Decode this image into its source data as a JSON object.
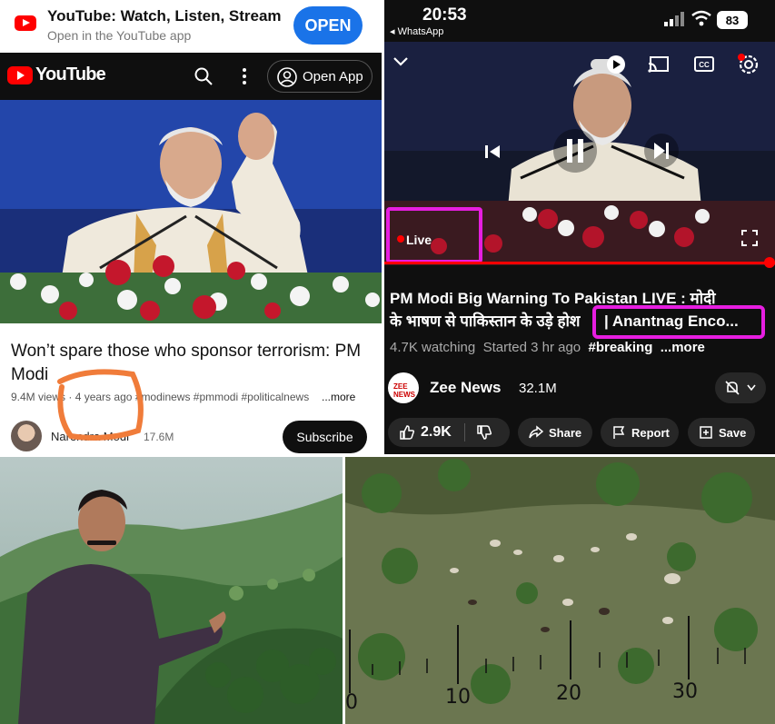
{
  "left_panel": {
    "banner": {
      "title": "YouTube: Watch, Listen, Stream",
      "subtitle": "Open in the YouTube app",
      "open_label": "OPEN"
    },
    "topbar": {
      "logo_text": "YouTube",
      "open_app_label": "Open App"
    },
    "video": {
      "title": "Won’t spare those who sponsor terrorism: PM Modi",
      "views": "9.4M views",
      "age": "4 years ago",
      "hashtags": "#modinews #pmmodi #politicalnews",
      "more_label": "...more",
      "channel_name": "Narendra Modi",
      "subscribers": "17.6M",
      "subscribe_label": "Subscribe"
    },
    "annotation_color": "#f07c3a"
  },
  "right_panel": {
    "status_bar": {
      "time": "20:53",
      "back_app": "◂ WhatsApp",
      "battery": "83"
    },
    "player": {
      "live_label": "Live"
    },
    "video": {
      "title_line1": "PM Modi Big Warning To Pakistan LIVE : मोदी",
      "title_line2": "के भाषण से पाकिस्तान के उड़े होश",
      "title_highlight": "| Anantnag Enco...",
      "watching": "4.7K watching",
      "started": "Started 3 hr ago",
      "tag": "#breaking",
      "more_label": "...more",
      "channel_name": "Zee News",
      "channel_logo_text": "ZEE NEWS",
      "subscribers": "32.1M"
    },
    "actions": {
      "likes": "2.9K",
      "share": "Share",
      "report": "Report",
      "save": "Save"
    },
    "annotation_color": "#e61ee0",
    "accent_red": "#ff0000"
  },
  "bottom_right": {
    "scale_labels": [
      "0",
      "10",
      "20",
      "30"
    ]
  }
}
